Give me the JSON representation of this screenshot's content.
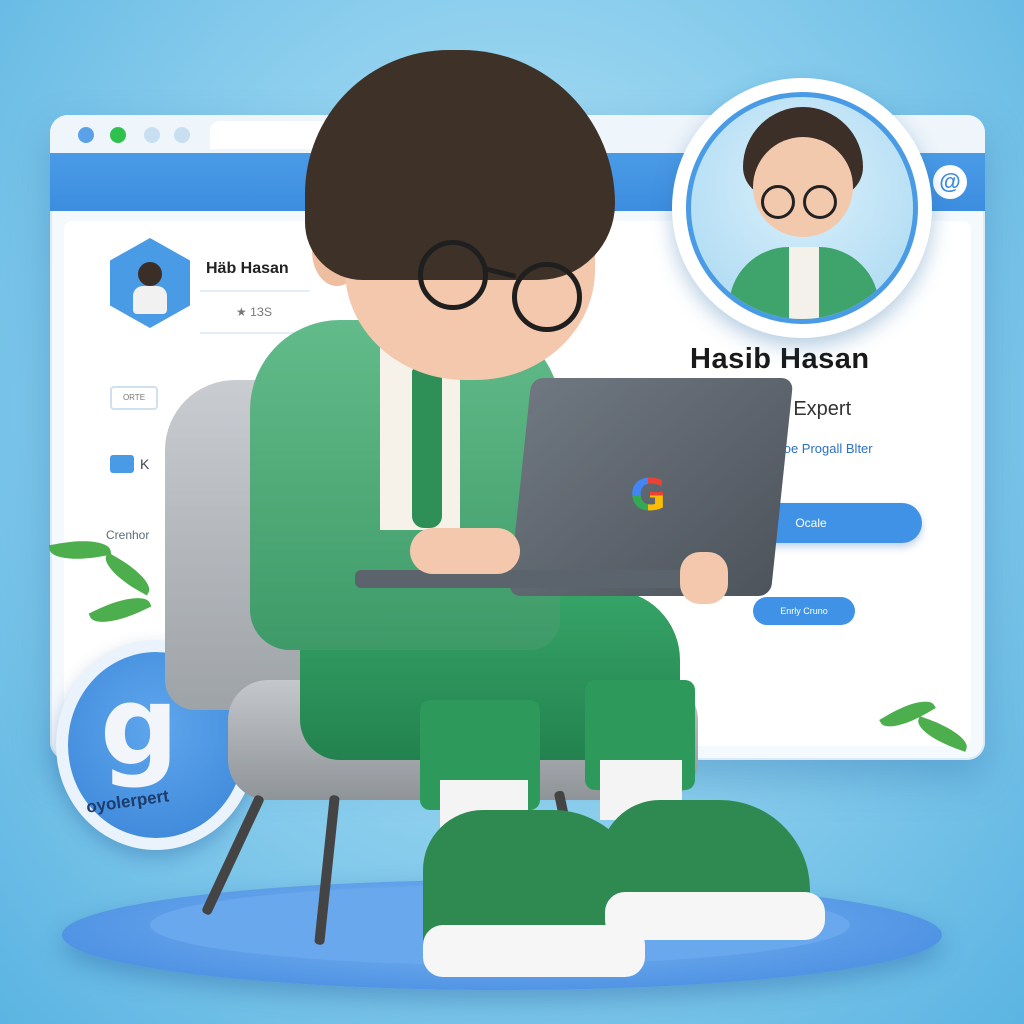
{
  "profile_card": {
    "small_name": "Häb Hasan",
    "badge_text": "★ 1ЗS",
    "name": "Hasib Hasan",
    "subtitle": "er Expert",
    "tagline": "spoe Progall Blter",
    "primary_button": "Ocale",
    "secondary_button": "Enrly Cruno"
  },
  "sidebar": {
    "chip_label": "ORTE",
    "k_label": "K",
    "text_label": "Crenhor"
  },
  "badge": {
    "letter": "g",
    "text": "oyolerpert"
  },
  "laptop": {
    "logo": "G"
  },
  "icons": {
    "browser_at": "@"
  },
  "colors": {
    "accent_blue": "#3f92e6",
    "jacket_green": "#3e9b68"
  }
}
